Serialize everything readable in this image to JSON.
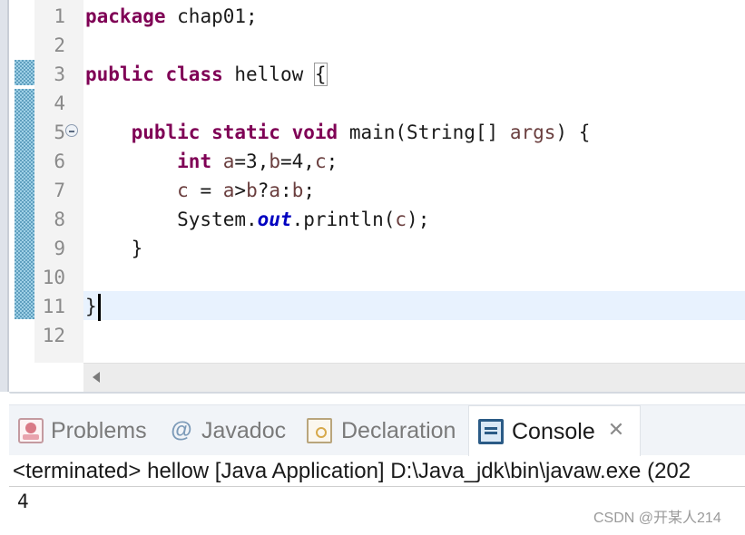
{
  "editor": {
    "line_numbers": [
      "1",
      "2",
      "3",
      "4",
      "5",
      "6",
      "7",
      "8",
      "9",
      "10",
      "11",
      "12"
    ],
    "lines": [
      [
        {
          "t": "package",
          "c": "kw"
        },
        {
          "t": " chap01;"
        }
      ],
      [],
      [
        {
          "t": "public",
          "c": "kw"
        },
        {
          "t": " "
        },
        {
          "t": "class",
          "c": "kw"
        },
        {
          "t": " hellow "
        },
        {
          "t": "{",
          "c": "brace-box"
        }
      ],
      [],
      [
        {
          "t": "    "
        },
        {
          "t": "public",
          "c": "kw"
        },
        {
          "t": " "
        },
        {
          "t": "static",
          "c": "kw"
        },
        {
          "t": " "
        },
        {
          "t": "void",
          "c": "kw"
        },
        {
          "t": " main(String[] "
        },
        {
          "t": "args",
          "c": "var"
        },
        {
          "t": ") {"
        }
      ],
      [
        {
          "t": "        "
        },
        {
          "t": "int",
          "c": "kw"
        },
        {
          "t": " "
        },
        {
          "t": "a",
          "c": "var"
        },
        {
          "t": "=3,"
        },
        {
          "t": "b",
          "c": "var"
        },
        {
          "t": "=4,"
        },
        {
          "t": "c",
          "c": "var"
        },
        {
          "t": ";"
        }
      ],
      [
        {
          "t": "        "
        },
        {
          "t": "c",
          "c": "var"
        },
        {
          "t": " = "
        },
        {
          "t": "a",
          "c": "var"
        },
        {
          "t": ">"
        },
        {
          "t": "b",
          "c": "var"
        },
        {
          "t": "?"
        },
        {
          "t": "a",
          "c": "var"
        },
        {
          "t": ":"
        },
        {
          "t": "b",
          "c": "var"
        },
        {
          "t": ";"
        }
      ],
      [
        {
          "t": "        System."
        },
        {
          "t": "out",
          "c": "field"
        },
        {
          "t": ".println("
        },
        {
          "t": "c",
          "c": "var"
        },
        {
          "t": ");"
        }
      ],
      [
        {
          "t": "    }"
        }
      ],
      [],
      [
        {
          "t": "}"
        },
        {
          "t": "",
          "c": "caret"
        }
      ],
      []
    ],
    "current_line": 11
  },
  "views": {
    "tabs": [
      {
        "label": "Problems",
        "icon": "problems-icon",
        "active": false
      },
      {
        "label": "Javadoc",
        "icon": "javadoc-icon",
        "active": false
      },
      {
        "label": "Declaration",
        "icon": "declaration-icon",
        "active": false
      },
      {
        "label": "Console",
        "icon": "console-icon",
        "active": true
      }
    ],
    "close_glyph": "✕"
  },
  "console": {
    "header": "<terminated> hellow [Java Application] D:\\Java_jdk\\bin\\javaw.exe (202",
    "output": "4"
  },
  "watermark": "CSDN @开某人214",
  "colors": {
    "keyword": "#7f0055",
    "variable": "#6a3e3e",
    "static_field": "#0000c0",
    "current_line_bg": "#e8f2fe",
    "tabbar_bg": "#f1f4f8"
  }
}
